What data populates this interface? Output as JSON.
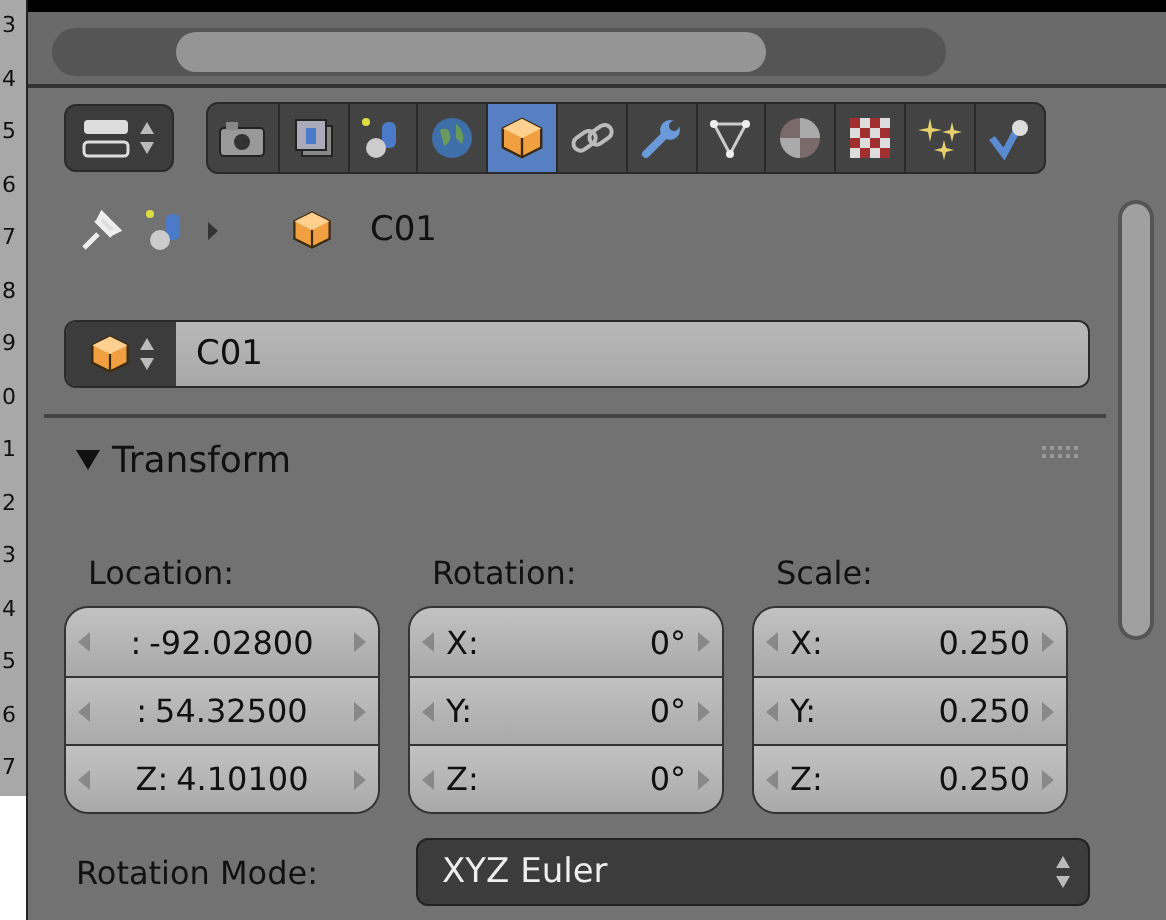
{
  "gutter_numbers": [
    "3",
    "4",
    "5",
    "6",
    "7",
    "8",
    "9",
    "0",
    "1",
    "2",
    "3",
    "4",
    "5",
    "6",
    "7"
  ],
  "view_toggle": {
    "kind": "layout"
  },
  "tabs": [
    {
      "kind": "camera",
      "selected": false
    },
    {
      "kind": "layers",
      "selected": false
    },
    {
      "kind": "shapes",
      "selected": false
    },
    {
      "kind": "globe",
      "selected": false
    },
    {
      "kind": "cube",
      "selected": true
    },
    {
      "kind": "chain",
      "selected": false
    },
    {
      "kind": "wrench",
      "selected": false
    },
    {
      "kind": "triangle",
      "selected": false
    },
    {
      "kind": "sphere",
      "selected": false
    },
    {
      "kind": "checker",
      "selected": false
    },
    {
      "kind": "sparkle",
      "selected": false
    },
    {
      "kind": "check",
      "selected": false
    }
  ],
  "breadcrumb": {
    "object": "C01"
  },
  "object_name": {
    "value": "C01"
  },
  "panel": {
    "title": "Transform",
    "expanded": true
  },
  "columns": [
    {
      "label": "Location:",
      "kind": "centered",
      "fields": [
        {
          "prefix": ":",
          "value": "-92.02800"
        },
        {
          "prefix": ":",
          "value": "54.32500"
        },
        {
          "prefix": "Z:",
          "value": "4.10100"
        }
      ]
    },
    {
      "label": "Rotation:",
      "kind": "spread",
      "fields": [
        {
          "prefix": "X:",
          "value": "0°"
        },
        {
          "prefix": "Y:",
          "value": "0°"
        },
        {
          "prefix": "Z:",
          "value": "0°"
        }
      ]
    },
    {
      "label": "Scale:",
      "kind": "spread",
      "fields": [
        {
          "prefix": "X:",
          "value": "0.250"
        },
        {
          "prefix": "Y:",
          "value": "0.250"
        },
        {
          "prefix": "Z:",
          "value": "0.250"
        }
      ]
    }
  ],
  "rotation_mode": {
    "label": "Rotation Mode:",
    "value": "XYZ Euler"
  }
}
